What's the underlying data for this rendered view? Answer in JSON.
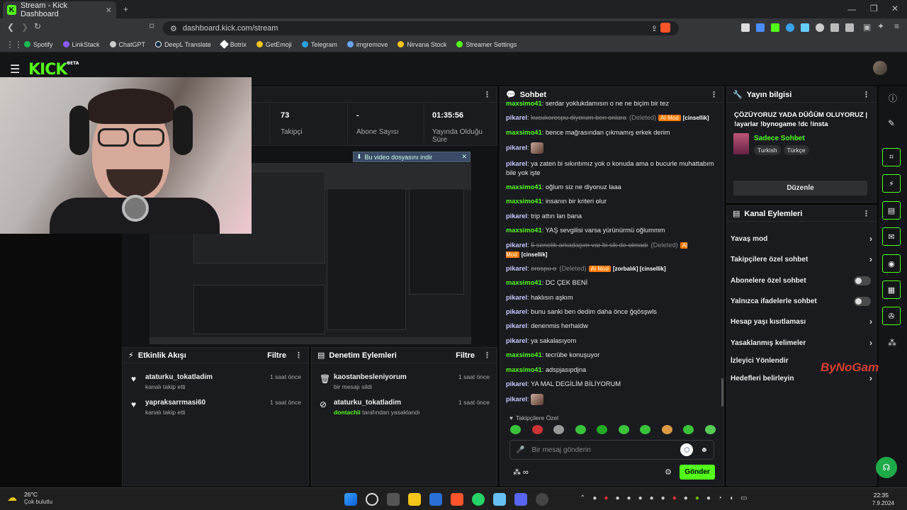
{
  "browser": {
    "tab_title": "Stream - Kick Dashboard",
    "url": "dashboard.kick.com/stream",
    "bookmarks": [
      {
        "label": "Spotify",
        "color": "#1db954"
      },
      {
        "label": "LinkStack",
        "color": "#8a5cf6"
      },
      {
        "label": "ChatGPT",
        "color": "#cccccc"
      },
      {
        "label": "DeepL Translate",
        "color": "#0f2b46"
      },
      {
        "label": "Botrix",
        "color": "#ffffff"
      },
      {
        "label": "GetEmoji",
        "color": "#f5c518"
      },
      {
        "label": "Telegram",
        "color": "#2aa1e0"
      },
      {
        "label": "imgremove",
        "color": "#6aa5ff"
      },
      {
        "label": "Nirvana Stock",
        "color": "#f5c518"
      },
      {
        "label": "Streamer Settings",
        "color": "#53fc18"
      }
    ]
  },
  "kick": {
    "logo": "KICK",
    "logo_beta": "BETA",
    "accent": "#53fc18"
  },
  "stats": [
    {
      "value": "73",
      "label": "Takipçi"
    },
    {
      "value": "-",
      "label": "Abone Sayısı"
    },
    {
      "value": "01:35:56",
      "label": "Yayında Olduğu Süre"
    }
  ],
  "video": {
    "download_bar": "Bu video dosyasını indir"
  },
  "activity": {
    "title": "Etkinlik Akışı",
    "filter": "Filtre",
    "items": [
      {
        "name": "ataturku_tokatladim",
        "sub": "kanalı takip etti",
        "time": "1 saat önce"
      },
      {
        "name": "yapraksarrmasi60",
        "sub": "kanalı takip etti",
        "time": "1 saat önce"
      }
    ]
  },
  "moderation": {
    "title": "Denetim Eylemleri",
    "filter": "Filtre",
    "items": [
      {
        "name": "kaostanbesleniyorum",
        "sub": "bir mesajı sildi",
        "time": "1 saat önce"
      },
      {
        "name": "ataturku_tokatladim",
        "actor": "dontachii",
        "sub": "tarafından yasaklandı",
        "time": "1 saat önce"
      }
    ]
  },
  "chat": {
    "title": "Sohbet",
    "messages": [
      {
        "user": "maxsimo41",
        "color": "#53fc18",
        "text": "serdar yoklukdamısın o ne ne biçim bir tez"
      },
      {
        "user": "pikarel",
        "color": "#c9c9ff",
        "text": "kucukorospu diyorum ben onlara",
        "deleted": true,
        "mod": "AI Mod",
        "tag": "[cinsellik]"
      },
      {
        "user": "maxsimo41",
        "color": "#53fc18",
        "text": "bence mağrasından çıkmamış erkek derim"
      },
      {
        "user": "pikarel",
        "color": "#c9c9ff",
        "text": "",
        "emote": true
      },
      {
        "user": "pikarel",
        "color": "#c9c9ff",
        "text": "ya zaten bi sıkıntımız yok o konuda ama o bucurle muhattabım bile yok işte"
      },
      {
        "user": "maxsimo41",
        "color": "#53fc18",
        "text": "oğlum siz ne diyonuz laaa"
      },
      {
        "user": "maxsimo41",
        "color": "#53fc18",
        "text": "insanın bir kriteri olur"
      },
      {
        "user": "pikarel",
        "color": "#c9c9ff",
        "text": "trip attın lan bana"
      },
      {
        "user": "maxsimo41",
        "color": "#53fc18",
        "text": "YAŞ sevgilisi varsa yürünürmü oğlummm"
      },
      {
        "user": "pikarel",
        "color": "#c9c9ff",
        "text": "5 senelik arkadaşım var bi sik de olmadı",
        "deleted": true,
        "mod": "AI Mod",
        "tag": "[cinsellik]"
      },
      {
        "user": "pikarel",
        "color": "#c9c9ff",
        "text": "orospu o",
        "deleted": true,
        "mod": "AI Mod",
        "tag": "[zorbalık] [cinsellik]"
      },
      {
        "user": "maxsimo41",
        "color": "#53fc18",
        "text": "DC ÇEK BENİ"
      },
      {
        "user": "pikarel",
        "color": "#c9c9ff",
        "text": "haklısın aşkım"
      },
      {
        "user": "pikarel",
        "color": "#c9c9ff",
        "text": "bunu sanki ben dedim daha önce ğqösşwls"
      },
      {
        "user": "pikarel",
        "color": "#c9c9ff",
        "text": "denenmis herhaldw"
      },
      {
        "user": "pikarel",
        "color": "#c9c9ff",
        "text": "ya sakalasıyom"
      },
      {
        "user": "maxsimo41",
        "color": "#53fc18",
        "text": "tecrübe konuşuyor"
      },
      {
        "user": "maxsimo41",
        "color": "#53fc18",
        "text": "adspjasıpdjna"
      },
      {
        "user": "pikarel",
        "color": "#c9c9ff",
        "text": "YA MAL DEGİLİM BİLİYORUM"
      },
      {
        "user": "pikarel",
        "color": "#c9c9ff",
        "text": "",
        "emote": true
      }
    ],
    "deleted_label": "(Deleted)",
    "followers_only": "Takipçilere Özel",
    "input_placeholder": "Bir mesaj gönderin",
    "send": "Gönder"
  },
  "stream_info": {
    "title": "Yayın bilgisi",
    "stream_title": "ÇÖZÜYORUZ YADA DÜĞÜM OLUYORUZ | !ayarlar !bynogame !dc !insta",
    "category": "Sadece Sohbet",
    "tags": [
      "Turkish",
      "Türkçe"
    ],
    "edit": "Düzenle"
  },
  "channel_actions": {
    "title": "Kanal Eylemleri",
    "items": [
      {
        "label": "Yavaş mod",
        "control": "chevron"
      },
      {
        "label": "Takipçilere özel sohbet",
        "control": "chevron"
      },
      {
        "label": "Abonelere özel sohbet",
        "control": "toggle"
      },
      {
        "label": "Yalnızca ifadelerle sohbet",
        "control": "toggle"
      },
      {
        "label": "Hesap yaşı kısıtlaması",
        "control": "chevron"
      },
      {
        "label": "Yasaklanmış kelimeler",
        "control": "chevron"
      },
      {
        "label": "İzleyici Yönlendir",
        "control": "none"
      },
      {
        "label": "Hedefleri belirleyin",
        "control": "chevron"
      }
    ]
  },
  "watermark": "ByNoGame",
  "taskbar": {
    "weather_temp": "26°C",
    "weather_desc": "Çok bulutlu",
    "time": "22:35",
    "date": "7.9.2024"
  }
}
